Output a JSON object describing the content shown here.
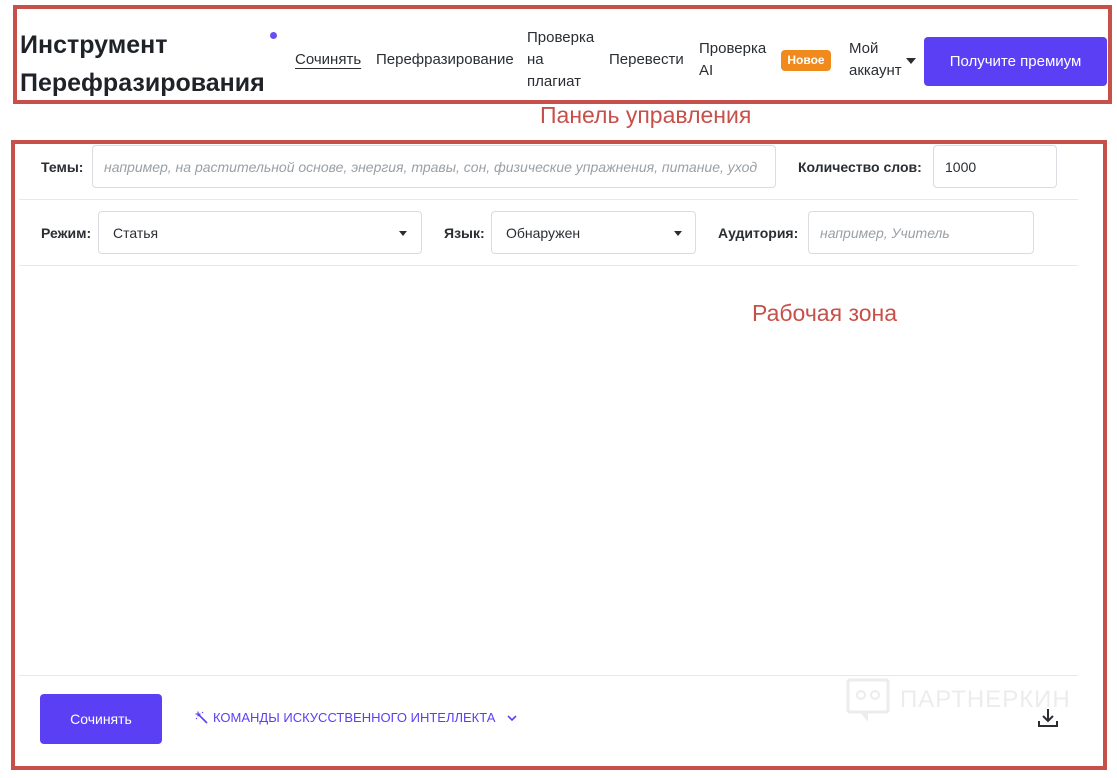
{
  "header": {
    "logo_line1": "Инструмент",
    "logo_line2": "Перефразирования",
    "nav": {
      "compose": "Сочинять",
      "paraphrase": "Перефразирование",
      "plagiarism": "Проверка на плагиат",
      "translate": "Перевести",
      "ai_check": "Проверка AI",
      "new_badge": "Новое",
      "account": "Мой аккаунт"
    },
    "premium_button": "Получите премиум"
  },
  "annotations": {
    "top_panel": "Панель управления",
    "work_area": "Рабочая зона"
  },
  "form": {
    "topics_label": "Темы:",
    "topics_placeholder": "например, на растительной основе, энергия, травы, сон, физические упражнения, питание, уход",
    "word_count_label": "Количество слов:",
    "word_count_value": "1000",
    "mode_label": "Режим:",
    "mode_value": "Статья",
    "language_label": "Язык:",
    "language_value": "Обнаружен",
    "audience_label": "Аудитория:",
    "audience_placeholder": "например, Учитель"
  },
  "footer": {
    "compose_button": "Сочинять",
    "ai_commands": "КОМАНДЫ ИСКУССТВЕННОГО ИНТЕЛЛЕКТА",
    "watermark": "ПАРТНЕРКИН"
  },
  "colors": {
    "accent": "#5b3ff5",
    "badge": "#f08a1c",
    "annotation": "#c8504a"
  },
  "icons": [
    "chevron-down-icon",
    "magic-wand-icon",
    "download-icon"
  ]
}
